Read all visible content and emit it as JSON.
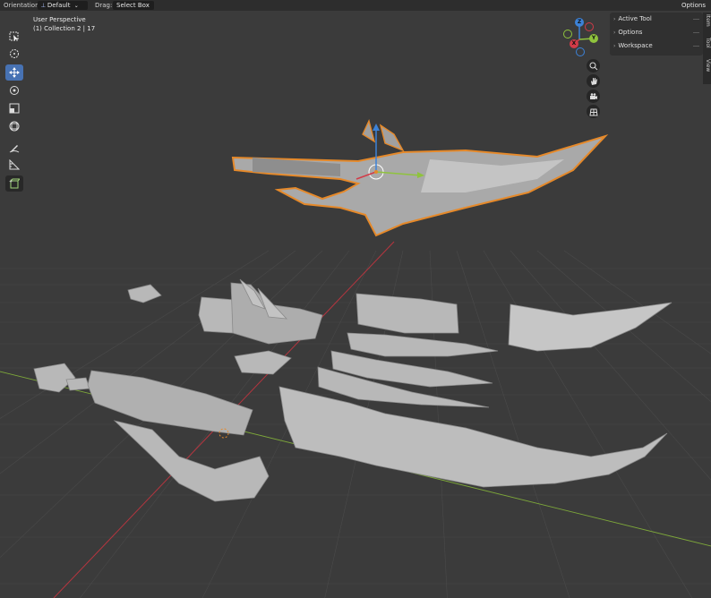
{
  "header": {
    "orientation_label": "Orientation:",
    "orientation_value": "Default",
    "drag_label": "Drag:",
    "drag_value": "Select Box",
    "options_label": "Options"
  },
  "viewport": {
    "view_name": "User Perspective",
    "collection_info": "(1) Collection 2 | 17"
  },
  "toolbar": {
    "tools": [
      {
        "name": "select-box",
        "active": false
      },
      {
        "name": "cursor",
        "active": false
      },
      {
        "name": "move",
        "active": true
      },
      {
        "name": "rotate",
        "active": false
      },
      {
        "name": "scale",
        "active": false
      },
      {
        "name": "transform",
        "active": false
      },
      {
        "name": "annotate",
        "active": false
      },
      {
        "name": "measure",
        "active": false
      },
      {
        "name": "add-cube",
        "active": false
      }
    ]
  },
  "gizmo": {
    "x": "X",
    "y": "Y",
    "z": "Z"
  },
  "panel": {
    "rows": [
      "Active Tool",
      "Options",
      "Workspace"
    ]
  },
  "side_tabs": [
    "Item",
    "Tool",
    "View"
  ],
  "colors": {
    "accent": "#4772b3",
    "selection_outline": "#e5892a",
    "axis_x": "#d23b48",
    "axis_y": "#8fc33d",
    "axis_z": "#3c82d8",
    "model_gray": "#b3b3b3"
  }
}
